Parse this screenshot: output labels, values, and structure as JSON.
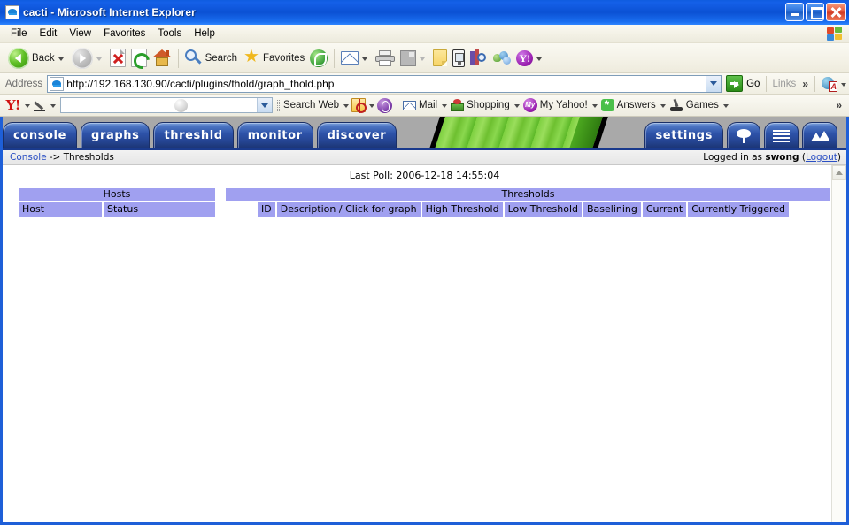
{
  "window": {
    "title": "cacti - Microsoft Internet Explorer",
    "icon": "ie-page-icon",
    "minimize_label": "Minimize",
    "maximize_label": "Maximize",
    "close_label": "Close"
  },
  "menubar": {
    "items": [
      "File",
      "Edit",
      "View",
      "Favorites",
      "Tools",
      "Help"
    ],
    "brand_icon": "windows-flag-icon"
  },
  "toolbar": {
    "back_label": "Back",
    "forward_label": "",
    "items": [
      {
        "name": "back",
        "label": "Back",
        "icon": "back-arrow-icon"
      },
      {
        "name": "forward",
        "label": "",
        "icon": "forward-arrow-icon"
      },
      {
        "name": "stop",
        "label": "",
        "icon": "stop-icon"
      },
      {
        "name": "refresh",
        "label": "",
        "icon": "refresh-icon"
      },
      {
        "name": "home",
        "label": "",
        "icon": "home-icon"
      },
      {
        "name": "search",
        "label": "Search",
        "icon": "search-icon"
      },
      {
        "name": "favorites",
        "label": "Favorites",
        "icon": "star-icon"
      },
      {
        "name": "history",
        "label": "",
        "icon": "history-icon"
      },
      {
        "name": "mail",
        "label": "",
        "icon": "mail-icon"
      },
      {
        "name": "print",
        "label": "",
        "icon": "printer-icon"
      },
      {
        "name": "edit",
        "label": "",
        "icon": "edit-page-icon"
      },
      {
        "name": "notes",
        "label": "",
        "icon": "note-icon"
      },
      {
        "name": "phone",
        "label": "",
        "icon": "mobile-phone-icon"
      },
      {
        "name": "research",
        "label": "",
        "icon": "research-icon"
      },
      {
        "name": "messenger",
        "label": "",
        "icon": "messenger-icon"
      },
      {
        "name": "yahoo",
        "label": "",
        "icon": "yahoo-icon"
      }
    ]
  },
  "address": {
    "label": "Address",
    "url": "http://192.168.130.90/cacti/plugins/thold/graph_thold.php",
    "favicon": "ie-page-icon",
    "dropdown_icon": "chevron-down-icon",
    "go_label": "Go",
    "go_icon": "go-arrow-icon",
    "links_label": "Links",
    "overflow_icon": "double-chevron-icon",
    "pdf_icon": "adobe-pdf-icon"
  },
  "yahoo_toolbar": {
    "logo": "Y!",
    "pencil_icon": "pencil-icon",
    "search_value": "",
    "search_placeholder": "",
    "search_web_label": "Search Web",
    "target_icon": "target-icon",
    "purple_icon": "yahoo-purple-icon",
    "items": [
      {
        "label": "Mail",
        "icon": "mail-icon"
      },
      {
        "label": "Shopping",
        "icon": "shopping-bag-icon"
      },
      {
        "label": "My Yahoo!",
        "icon": "my-yahoo-icon"
      },
      {
        "label": "Answers",
        "icon": "answers-icon"
      },
      {
        "label": "Games",
        "icon": "joystick-icon"
      }
    ],
    "overflow_icon": "double-chevron-icon"
  },
  "cacti": {
    "tabs": [
      {
        "label": "console",
        "name": "tab-console"
      },
      {
        "label": "graphs",
        "name": "tab-graphs"
      },
      {
        "label": "threshld",
        "name": "tab-threshld"
      },
      {
        "label": "monitor",
        "name": "tab-monitor"
      },
      {
        "label": "discover",
        "name": "tab-discover"
      }
    ],
    "right_tabs": [
      {
        "label": "settings",
        "name": "tab-settings",
        "icon": ""
      },
      {
        "label": "",
        "name": "tab-cacti-tree",
        "icon": "tree-icon"
      },
      {
        "label": "",
        "name": "tab-list",
        "icon": "list-icon"
      },
      {
        "label": "",
        "name": "tab-graph-view",
        "icon": "mountain-graph-icon"
      }
    ],
    "breadcrumb": {
      "link": "Console",
      "rest": "-> Thresholds"
    },
    "login_status": {
      "prefix": "Logged in as ",
      "user": "swong",
      "logout_open": " (",
      "logout": "Logout",
      "logout_close": ")"
    },
    "last_poll": "Last Poll: 2006-12-18 14:55:04",
    "hosts_table": {
      "title": "Hosts",
      "columns": [
        "Host",
        "Status"
      ],
      "rows": []
    },
    "thresholds_table": {
      "title": "Thresholds",
      "columns": [
        "ID",
        "Description / Click for graph",
        "High Threshold",
        "Low Threshold",
        "Baselining",
        "Current",
        "Currently Triggered"
      ],
      "rows": []
    },
    "colors": {
      "header_bg": "#a0a0f0",
      "tab_blue": "#2d52a8",
      "banner_green": "#7ed040",
      "link": "#2a4fc4"
    }
  },
  "scrollbar": {
    "up_icon": "chevron-up-icon"
  }
}
